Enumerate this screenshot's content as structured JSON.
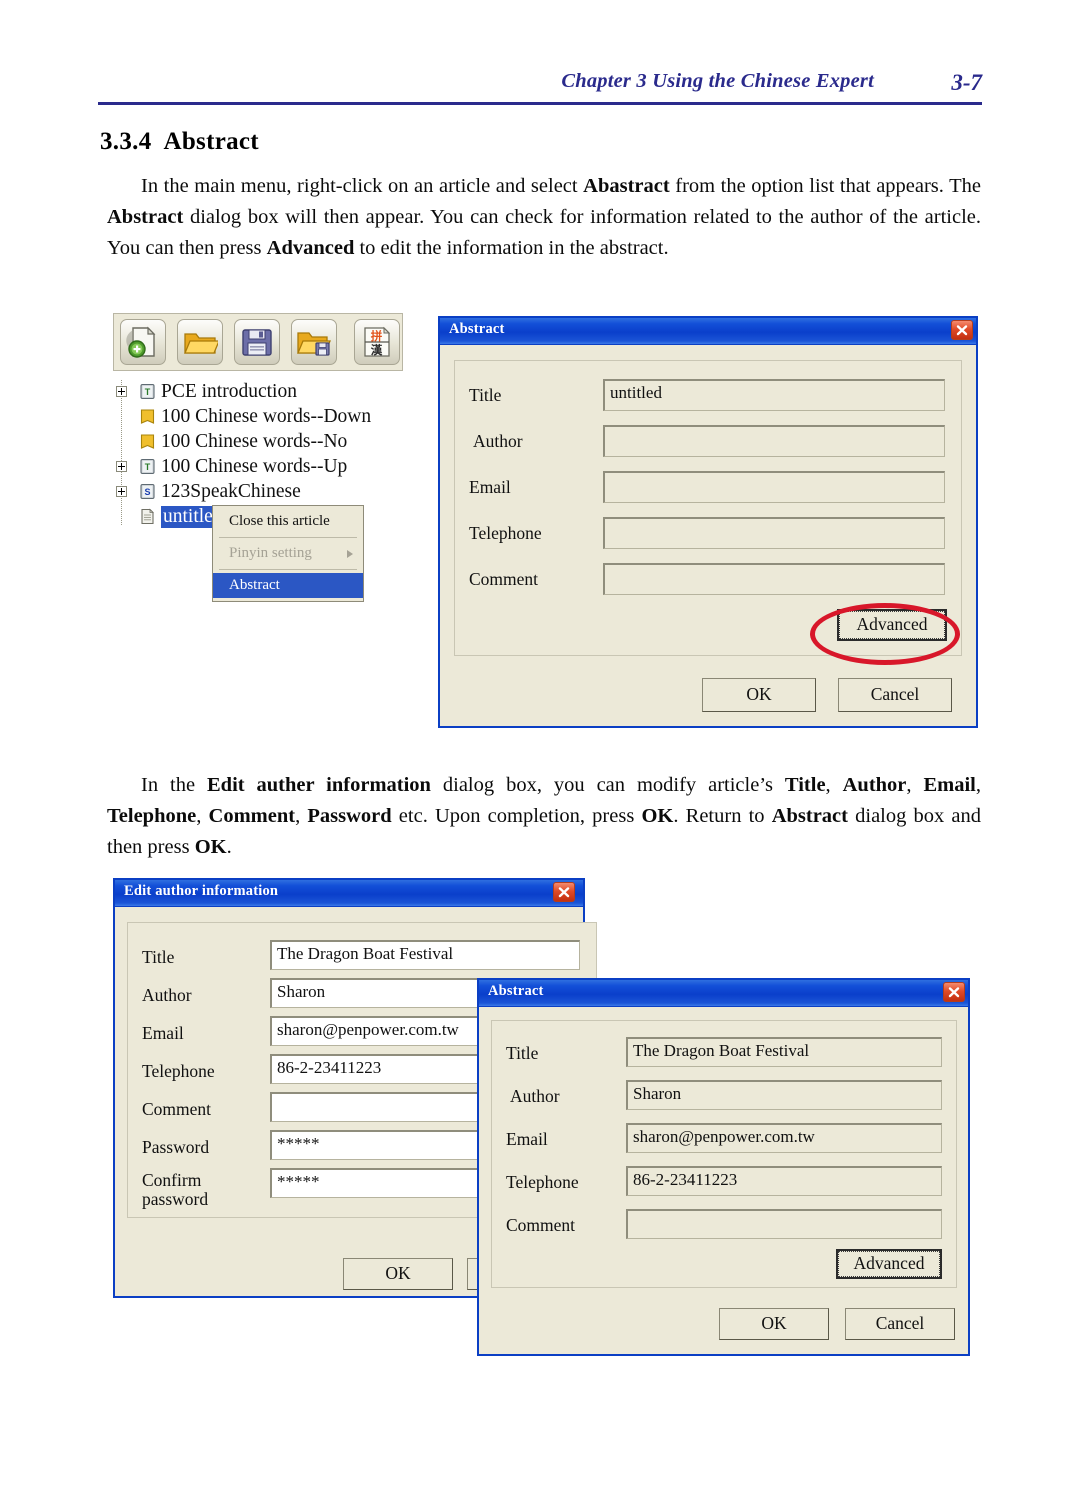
{
  "header": {
    "chapter": "Chapter 3  Using the Chinese Expert",
    "page_number": "3-7"
  },
  "section": {
    "number": "3.3.4",
    "title": "Abstract"
  },
  "paragraphs": {
    "intro_html": "In the main menu, right-click on an article and select <b>Abastract</b> from the option list that appears. The <b>Abstract</b> dialog box will then appear. You can check for information related to the author of the article. You can then press <b>Advanced</b> to edit the information in the abstract.",
    "edit_html": "In the <b>Edit auther information</b> dialog box, you can modify article&rsquo;s <b>Title</b>, <b>Author</b>, <b>Email</b>, <b>Telephone</b>, <b>Comment</b>, <b>Password</b> etc. Upon completion, press <b>OK</b>. Return to <b>Abstract</b> dialog box and then press <b>OK</b>."
  },
  "toolbar": {
    "buttons": [
      {
        "name": "new-article-icon",
        "tooltip": "New article"
      },
      {
        "name": "open-folder-icon",
        "tooltip": "Open"
      },
      {
        "name": "save-icon",
        "tooltip": "Save"
      },
      {
        "name": "save-as-icon",
        "tooltip": "Save as"
      },
      {
        "name": "pinyin-hanzi-icon",
        "tooltip": "Pinyin / Hanzi",
        "glyph_top": "拼",
        "glyph_bottom": "漢"
      }
    ]
  },
  "tree": {
    "items": [
      {
        "label": "PCE introduction",
        "icon": "book-t-icon",
        "expandable": true,
        "selected": false
      },
      {
        "label": "100 Chinese words--Down",
        "icon": "book-plain-icon",
        "expandable": false,
        "selected": false
      },
      {
        "label": "100 Chinese words--No",
        "icon": "book-plain-icon",
        "expandable": false,
        "selected": false
      },
      {
        "label": "100 Chinese words--Up",
        "icon": "book-t-icon",
        "expandable": true,
        "selected": false
      },
      {
        "label": "123SpeakChinese",
        "icon": "book-s-icon",
        "expandable": true,
        "selected": false
      },
      {
        "label": "untitled",
        "icon": "document-icon",
        "expandable": false,
        "selected": true
      }
    ]
  },
  "context_menu": {
    "items": [
      {
        "label": "Close this article",
        "state": "normal",
        "submenu": false
      },
      {
        "label": "Pinyin setting",
        "state": "disabled",
        "submenu": true
      },
      {
        "label": "Abstract",
        "state": "highlighted",
        "submenu": false
      }
    ]
  },
  "abstract_dialog_empty": {
    "title": "Abstract",
    "close_icon": "close-icon",
    "fields": [
      {
        "label": "Title",
        "value": "untitled"
      },
      {
        "label": "Author",
        "value": ""
      },
      {
        "label": "Email",
        "value": ""
      },
      {
        "label": "Telephone",
        "value": ""
      },
      {
        "label": "Comment",
        "value": ""
      }
    ],
    "advanced_label": "Advanced",
    "ok_label": "OK",
    "cancel_label": "Cancel"
  },
  "edit_author_dialog": {
    "title": "Edit author information",
    "close_icon": "close-icon",
    "fields": [
      {
        "label": "Title",
        "value": "The Dragon Boat Festival"
      },
      {
        "label": "Author",
        "value": "Sharon"
      },
      {
        "label": "Email",
        "value": "sharon@penpower.com.tw"
      },
      {
        "label": "Telephone",
        "value": "86-2-23411223"
      },
      {
        "label": "Comment",
        "value": ""
      },
      {
        "label": "Password",
        "value": "*****"
      },
      {
        "label": "Confirm password",
        "value": "*****"
      }
    ],
    "ok_label": "OK"
  },
  "abstract_dialog_filled": {
    "title": "Abstract",
    "close_icon": "close-icon",
    "fields": [
      {
        "label": "Title",
        "value": "The Dragon Boat Festival"
      },
      {
        "label": "Author",
        "value": "Sharon"
      },
      {
        "label": "Email",
        "value": "sharon@penpower.com.tw"
      },
      {
        "label": "Telephone",
        "value": "86-2-23411223"
      },
      {
        "label": "Comment",
        "value": ""
      }
    ],
    "advanced_label": "Advanced",
    "ok_label": "OK",
    "cancel_label": "Cancel"
  },
  "annotation": {
    "shape": "ellipse",
    "color": "#d8172a",
    "target": "Advanced"
  },
  "colors": {
    "header_blue": "#2a2a8c",
    "titlebar_blue": "#0a3fcb",
    "dialog_face": "#ece9d8",
    "selection_blue": "#2b57c4",
    "annotation_red": "#d8172a"
  }
}
